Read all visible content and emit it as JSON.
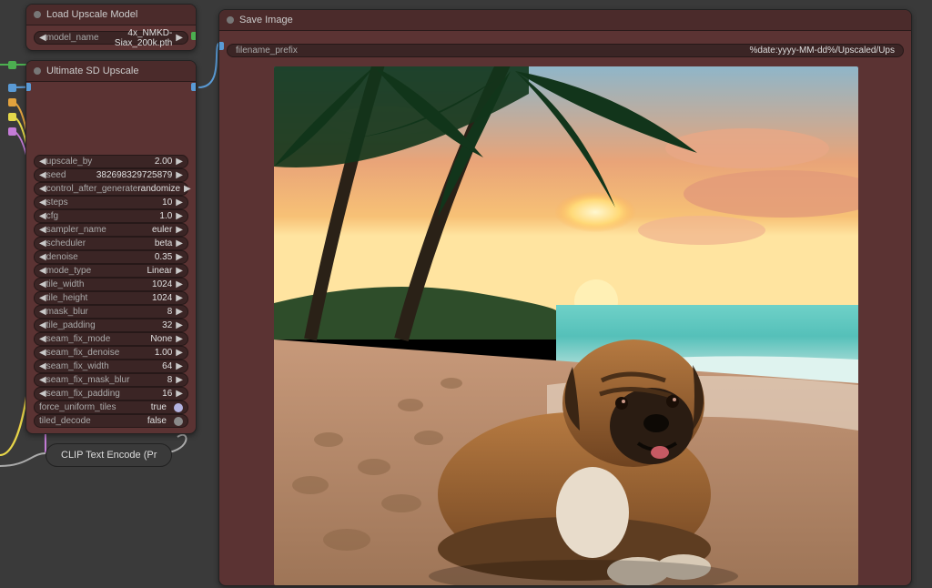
{
  "load_upscale_model": {
    "title": "Load Upscale Model",
    "model_name_label": "model_name",
    "model_name_value": "4x_NMKD-Siax_200k.pth"
  },
  "ultimate_sd_upscale": {
    "title": "Ultimate SD Upscale",
    "params": [
      {
        "label": "upscale_by",
        "value": "2.00",
        "type": "num"
      },
      {
        "label": "seed",
        "value": "382698329725879",
        "type": "num"
      },
      {
        "label": "control_after_generate",
        "value": "randomize",
        "type": "enum"
      },
      {
        "label": "steps",
        "value": "10",
        "type": "num"
      },
      {
        "label": "cfg",
        "value": "1.0",
        "type": "num"
      },
      {
        "label": "sampler_name",
        "value": "euler",
        "type": "enum"
      },
      {
        "label": "scheduler",
        "value": "beta",
        "type": "enum"
      },
      {
        "label": "denoise",
        "value": "0.35",
        "type": "num"
      },
      {
        "label": "mode_type",
        "value": "Linear",
        "type": "enum"
      },
      {
        "label": "tile_width",
        "value": "1024",
        "type": "num"
      },
      {
        "label": "tile_height",
        "value": "1024",
        "type": "num"
      },
      {
        "label": "mask_blur",
        "value": "8",
        "type": "num"
      },
      {
        "label": "tile_padding",
        "value": "32",
        "type": "num"
      },
      {
        "label": "seam_fix_mode",
        "value": "None",
        "type": "enum"
      },
      {
        "label": "seam_fix_denoise",
        "value": "1.00",
        "type": "num"
      },
      {
        "label": "seam_fix_width",
        "value": "64",
        "type": "num"
      },
      {
        "label": "seam_fix_mask_blur",
        "value": "8",
        "type": "num"
      },
      {
        "label": "seam_fix_padding",
        "value": "16",
        "type": "num"
      },
      {
        "label": "force_uniform_tiles",
        "value": "true",
        "type": "toggle_on"
      },
      {
        "label": "tiled_decode",
        "value": "false",
        "type": "toggle_off"
      }
    ]
  },
  "clip_encode": {
    "title": "CLIP Text Encode (Pr"
  },
  "save_image": {
    "title": "Save Image",
    "filename_prefix_label": "filename_prefix",
    "filename_prefix_value": "%date:yyyy-MM-dd%/Upscaled/Ups"
  }
}
